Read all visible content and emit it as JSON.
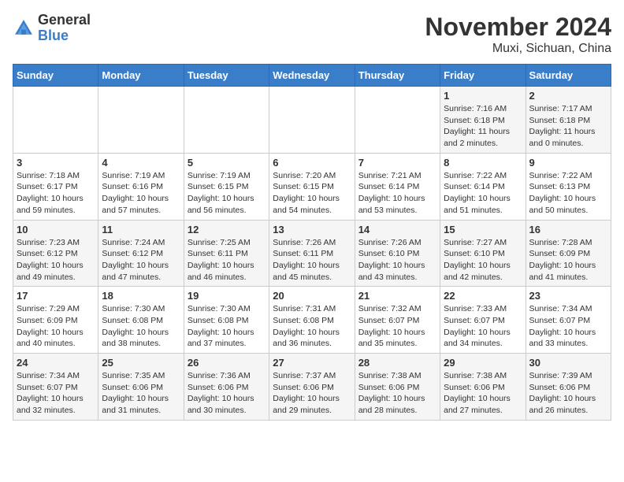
{
  "header": {
    "logo_general": "General",
    "logo_blue": "Blue",
    "title": "November 2024",
    "subtitle": "Muxi, Sichuan, China"
  },
  "weekdays": [
    "Sunday",
    "Monday",
    "Tuesday",
    "Wednesday",
    "Thursday",
    "Friday",
    "Saturday"
  ],
  "weeks": [
    [
      {
        "day": "",
        "info": ""
      },
      {
        "day": "",
        "info": ""
      },
      {
        "day": "",
        "info": ""
      },
      {
        "day": "",
        "info": ""
      },
      {
        "day": "",
        "info": ""
      },
      {
        "day": "1",
        "info": "Sunrise: 7:16 AM\nSunset: 6:18 PM\nDaylight: 11 hours and 2 minutes."
      },
      {
        "day": "2",
        "info": "Sunrise: 7:17 AM\nSunset: 6:18 PM\nDaylight: 11 hours and 0 minutes."
      }
    ],
    [
      {
        "day": "3",
        "info": "Sunrise: 7:18 AM\nSunset: 6:17 PM\nDaylight: 10 hours and 59 minutes."
      },
      {
        "day": "4",
        "info": "Sunrise: 7:19 AM\nSunset: 6:16 PM\nDaylight: 10 hours and 57 minutes."
      },
      {
        "day": "5",
        "info": "Sunrise: 7:19 AM\nSunset: 6:15 PM\nDaylight: 10 hours and 56 minutes."
      },
      {
        "day": "6",
        "info": "Sunrise: 7:20 AM\nSunset: 6:15 PM\nDaylight: 10 hours and 54 minutes."
      },
      {
        "day": "7",
        "info": "Sunrise: 7:21 AM\nSunset: 6:14 PM\nDaylight: 10 hours and 53 minutes."
      },
      {
        "day": "8",
        "info": "Sunrise: 7:22 AM\nSunset: 6:14 PM\nDaylight: 10 hours and 51 minutes."
      },
      {
        "day": "9",
        "info": "Sunrise: 7:22 AM\nSunset: 6:13 PM\nDaylight: 10 hours and 50 minutes."
      }
    ],
    [
      {
        "day": "10",
        "info": "Sunrise: 7:23 AM\nSunset: 6:12 PM\nDaylight: 10 hours and 49 minutes."
      },
      {
        "day": "11",
        "info": "Sunrise: 7:24 AM\nSunset: 6:12 PM\nDaylight: 10 hours and 47 minutes."
      },
      {
        "day": "12",
        "info": "Sunrise: 7:25 AM\nSunset: 6:11 PM\nDaylight: 10 hours and 46 minutes."
      },
      {
        "day": "13",
        "info": "Sunrise: 7:26 AM\nSunset: 6:11 PM\nDaylight: 10 hours and 45 minutes."
      },
      {
        "day": "14",
        "info": "Sunrise: 7:26 AM\nSunset: 6:10 PM\nDaylight: 10 hours and 43 minutes."
      },
      {
        "day": "15",
        "info": "Sunrise: 7:27 AM\nSunset: 6:10 PM\nDaylight: 10 hours and 42 minutes."
      },
      {
        "day": "16",
        "info": "Sunrise: 7:28 AM\nSunset: 6:09 PM\nDaylight: 10 hours and 41 minutes."
      }
    ],
    [
      {
        "day": "17",
        "info": "Sunrise: 7:29 AM\nSunset: 6:09 PM\nDaylight: 10 hours and 40 minutes."
      },
      {
        "day": "18",
        "info": "Sunrise: 7:30 AM\nSunset: 6:08 PM\nDaylight: 10 hours and 38 minutes."
      },
      {
        "day": "19",
        "info": "Sunrise: 7:30 AM\nSunset: 6:08 PM\nDaylight: 10 hours and 37 minutes."
      },
      {
        "day": "20",
        "info": "Sunrise: 7:31 AM\nSunset: 6:08 PM\nDaylight: 10 hours and 36 minutes."
      },
      {
        "day": "21",
        "info": "Sunrise: 7:32 AM\nSunset: 6:07 PM\nDaylight: 10 hours and 35 minutes."
      },
      {
        "day": "22",
        "info": "Sunrise: 7:33 AM\nSunset: 6:07 PM\nDaylight: 10 hours and 34 minutes."
      },
      {
        "day": "23",
        "info": "Sunrise: 7:34 AM\nSunset: 6:07 PM\nDaylight: 10 hours and 33 minutes."
      }
    ],
    [
      {
        "day": "24",
        "info": "Sunrise: 7:34 AM\nSunset: 6:07 PM\nDaylight: 10 hours and 32 minutes."
      },
      {
        "day": "25",
        "info": "Sunrise: 7:35 AM\nSunset: 6:06 PM\nDaylight: 10 hours and 31 minutes."
      },
      {
        "day": "26",
        "info": "Sunrise: 7:36 AM\nSunset: 6:06 PM\nDaylight: 10 hours and 30 minutes."
      },
      {
        "day": "27",
        "info": "Sunrise: 7:37 AM\nSunset: 6:06 PM\nDaylight: 10 hours and 29 minutes."
      },
      {
        "day": "28",
        "info": "Sunrise: 7:38 AM\nSunset: 6:06 PM\nDaylight: 10 hours and 28 minutes."
      },
      {
        "day": "29",
        "info": "Sunrise: 7:38 AM\nSunset: 6:06 PM\nDaylight: 10 hours and 27 minutes."
      },
      {
        "day": "30",
        "info": "Sunrise: 7:39 AM\nSunset: 6:06 PM\nDaylight: 10 hours and 26 minutes."
      }
    ]
  ]
}
